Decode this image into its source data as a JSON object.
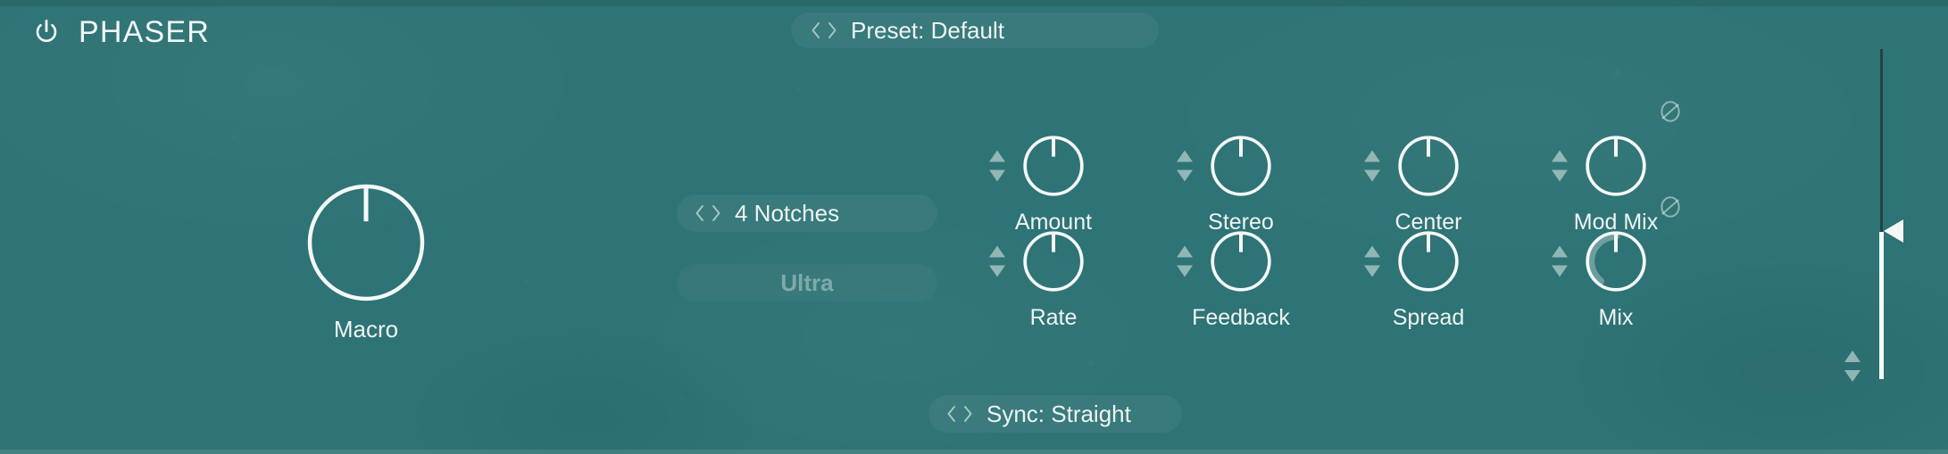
{
  "plugin": {
    "title": "PHASER",
    "power_icon": "power-icon",
    "background_color": "#2e7375",
    "foreground_color": "#eef4f3"
  },
  "header": {
    "preset": {
      "label": "Preset: Default",
      "prev_icon": "chevron-left-icon",
      "next_icon": "chevron-right-icon"
    }
  },
  "macro": {
    "label": "Macro",
    "value_percent": 0
  },
  "selectors": {
    "notches": {
      "label": "4 Notches",
      "prev_icon": "chevron-left-icon",
      "next_icon": "chevron-right-icon"
    },
    "ultra": {
      "label": "Ultra",
      "enabled": false
    },
    "sync": {
      "label": "Sync: Straight",
      "prev_icon": "chevron-left-icon",
      "next_icon": "chevron-right-icon"
    }
  },
  "knobs": {
    "row1": [
      {
        "label": "Amount",
        "value_percent": 0,
        "phase_invert": false
      },
      {
        "label": "Stereo",
        "value_percent": 0,
        "phase_invert": false
      },
      {
        "label": "Center",
        "value_percent": 0,
        "phase_invert": false
      },
      {
        "label": "Mod Mix",
        "value_percent": 0,
        "phase_invert": true,
        "phase_icon": "phase-invert-icon"
      }
    ],
    "row2": [
      {
        "label": "Rate",
        "value_percent": 0,
        "phase_invert": false
      },
      {
        "label": "Feedback",
        "value_percent": 0,
        "phase_invert": false
      },
      {
        "label": "Spread",
        "value_percent": 0,
        "phase_invert": false
      },
      {
        "label": "Mix",
        "value_percent": 0,
        "phase_invert": true,
        "phase_icon": "phase-invert-icon",
        "mod_arc": true
      }
    ],
    "stepper_up_icon": "triangle-up-icon",
    "stepper_down_icon": "triangle-down-icon"
  },
  "output_slider": {
    "value_percent": 45,
    "handle_icon": "slider-handle-icon",
    "stepper_up_icon": "triangle-up-icon",
    "stepper_down_icon": "triangle-down-icon"
  }
}
